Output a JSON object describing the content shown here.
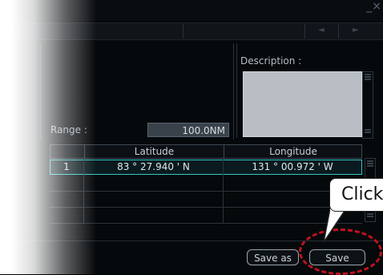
{
  "window": {
    "minimize_glyph": "_",
    "close_glyph": "×"
  },
  "toolbar": {
    "prev_glyph": "◄",
    "next_glyph": "►"
  },
  "description": {
    "label": "Description :",
    "value": ""
  },
  "range": {
    "label": "Range :",
    "value": "100.0NM"
  },
  "table": {
    "headers": [
      "",
      "Latitude",
      "Longitude"
    ],
    "rows": [
      {
        "index": "1",
        "latitude": "83 ° 27.940 ' N",
        "longitude": "131 ° 00.972 ' W"
      },
      {
        "index": "",
        "latitude": "",
        "longitude": ""
      },
      {
        "index": "",
        "latitude": "",
        "longitude": ""
      },
      {
        "index": "",
        "latitude": "",
        "longitude": ""
      }
    ]
  },
  "buttons": {
    "save_as": "Save as",
    "save": "Save"
  },
  "callout": {
    "text": "Click"
  },
  "colors": {
    "selection": "#34c6c8",
    "callout_red": "#c1121f"
  }
}
